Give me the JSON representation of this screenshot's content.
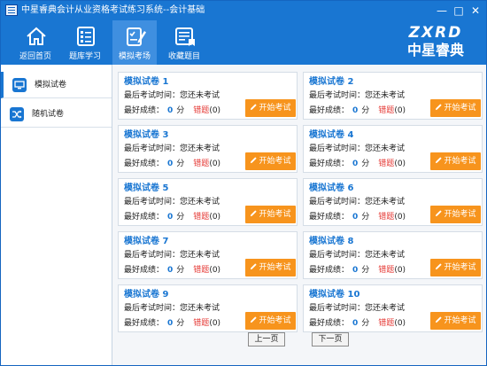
{
  "window": {
    "title": "中星睿典会计从业资格考试练习系统--会计基础",
    "minimize": "—",
    "maximize": "□",
    "close": "✕"
  },
  "toolbar": {
    "items": [
      {
        "label": "返回首页",
        "icon": "home-icon"
      },
      {
        "label": "题库学习",
        "icon": "list-icon"
      },
      {
        "label": "模拟考场",
        "icon": "exam-icon"
      },
      {
        "label": "收藏题目",
        "icon": "bookmark-list-icon"
      }
    ],
    "brand_en": "ZXRD",
    "brand_cn": "中星睿典",
    "color": "#1976d2"
  },
  "sidebar": {
    "items": [
      {
        "label": "模拟试卷",
        "icon": "monitor-icon"
      },
      {
        "label": "随机试卷",
        "icon": "shuffle-icon"
      }
    ]
  },
  "exams": {
    "last_time_label": "最后考试时间：",
    "last_time_value": "您还未考试",
    "best_score_label": "最好成绩：",
    "score_unit": "分",
    "wrong_label": "错题",
    "start_label": "开始考试",
    "items": [
      {
        "title": "模拟试卷 1",
        "score": "0",
        "wrong_count": "(0)"
      },
      {
        "title": "模拟试卷 2",
        "score": "0",
        "wrong_count": "(0)"
      },
      {
        "title": "模拟试卷 3",
        "score": "0",
        "wrong_count": "(0)"
      },
      {
        "title": "模拟试卷 4",
        "score": "0",
        "wrong_count": "(0)"
      },
      {
        "title": "模拟试卷 5",
        "score": "0",
        "wrong_count": "(0)"
      },
      {
        "title": "模拟试卷 6",
        "score": "0",
        "wrong_count": "(0)"
      },
      {
        "title": "模拟试卷 7",
        "score": "0",
        "wrong_count": "(0)"
      },
      {
        "title": "模拟试卷 8",
        "score": "0",
        "wrong_count": "(0)"
      },
      {
        "title": "模拟试卷 9",
        "score": "0",
        "wrong_count": "(0)"
      },
      {
        "title": "模拟试卷 10",
        "score": "0",
        "wrong_count": "(0)"
      }
    ],
    "accent_color": "#f7941d",
    "wrong_color": "#e53935"
  },
  "pager": {
    "prev_label": "上一页",
    "next_label": "下一页"
  }
}
